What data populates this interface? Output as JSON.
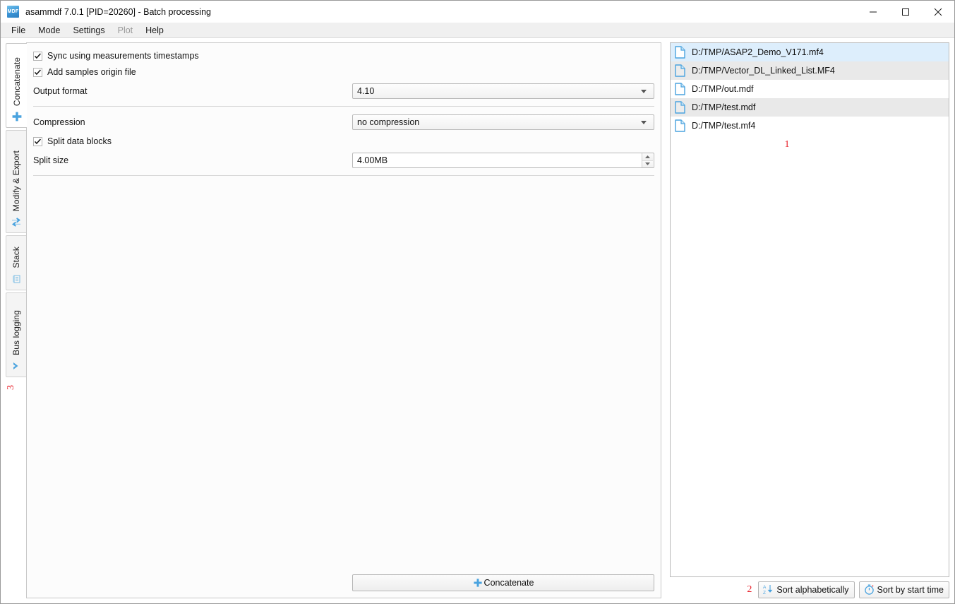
{
  "window": {
    "title": "asammdf 7.0.1 [PID=20260] - Batch processing",
    "app_icon": "mdf-logo-icon",
    "controls": {
      "minimize": "minimize-icon",
      "maximize": "maximize-icon",
      "close": "close-icon"
    }
  },
  "menubar": {
    "items": [
      {
        "label": "File",
        "disabled": false
      },
      {
        "label": "Mode",
        "disabled": false
      },
      {
        "label": "Settings",
        "disabled": false
      },
      {
        "label": "Plot",
        "disabled": true
      },
      {
        "label": "Help",
        "disabled": false
      }
    ]
  },
  "sidebar": {
    "tabs": [
      {
        "label": "Concatenate",
        "icon": "plus-icon",
        "active": true
      },
      {
        "label": "Modify & Export",
        "icon": "swap-arrows-icon",
        "active": false
      },
      {
        "label": "Stack",
        "icon": "stack-layers-icon",
        "active": false
      },
      {
        "label": "Bus logging",
        "icon": "chevron-right-icon",
        "active": false
      }
    ],
    "marker": "3"
  },
  "main": {
    "sync_checkbox": {
      "label": "Sync using measurements timestamps",
      "checked": true
    },
    "origin_checkbox": {
      "label": "Add samples origin file",
      "checked": true
    },
    "output_format": {
      "label": "Output format",
      "value": "4.10"
    },
    "compression": {
      "label": "Compression",
      "value": "no compression"
    },
    "split_checkbox": {
      "label": "Split data blocks",
      "checked": true
    },
    "split_size": {
      "label": "Split size",
      "value": "4.00MB"
    },
    "action_button": {
      "label": "Concatenate",
      "icon": "plus-icon"
    }
  },
  "filelist": {
    "items": [
      {
        "path": "D:/TMP/ASAP2_Demo_V171.mf4",
        "selected": true,
        "alt": false
      },
      {
        "path": "D:/TMP/Vector_DL_Linked_List.MF4",
        "selected": false,
        "alt": true
      },
      {
        "path": "D:/TMP/out.mdf",
        "selected": false,
        "alt": false
      },
      {
        "path": "D:/TMP/test.mdf",
        "selected": false,
        "alt": true
      },
      {
        "path": "D:/TMP/test.mf4",
        "selected": false,
        "alt": false
      }
    ],
    "marker": "1"
  },
  "bottom": {
    "marker": "2",
    "sort_alpha": {
      "label": "Sort alphabetically",
      "icon": "sort-az-icon"
    },
    "sort_time": {
      "label": "Sort by start time",
      "icon": "stopwatch-icon"
    }
  },
  "colors": {
    "accent": "#4aa3df",
    "marker_red": "#e8202a",
    "selection": "#ddeefc",
    "alt_row": "#e9e9e9"
  }
}
